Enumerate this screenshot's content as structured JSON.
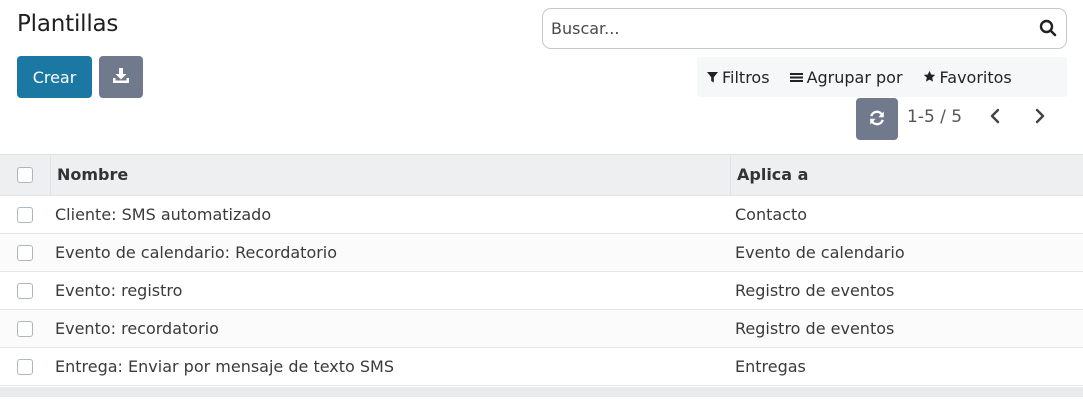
{
  "page": {
    "title": "Plantillas"
  },
  "search": {
    "placeholder": "Buscar..."
  },
  "toolbar": {
    "create_label": "Crear"
  },
  "filters": {
    "filters_label": "Filtros",
    "group_label": "Agrupar por",
    "favorites_label": "Favoritos"
  },
  "pager": {
    "value": "1-5 / 5"
  },
  "table": {
    "columns": [
      "Nombre",
      "Aplica a"
    ],
    "rows": [
      {
        "name": "Cliente: SMS automatizado",
        "applies_to": "Contacto"
      },
      {
        "name": "Evento de calendario: Recordatorio",
        "applies_to": "Evento de calendario"
      },
      {
        "name": "Evento: registro",
        "applies_to": "Registro de eventos"
      },
      {
        "name": "Evento: recordatorio",
        "applies_to": "Registro de eventos"
      },
      {
        "name": "Entrega: Enviar por mensaje de texto SMS",
        "applies_to": "Entregas"
      }
    ]
  },
  "colors": {
    "primary": "#1b78a3",
    "secondary": "#71798c",
    "header_bg": "#eeeff1"
  },
  "icons": [
    "search-icon",
    "download-icon",
    "filter-icon",
    "list-icon",
    "star-icon",
    "refresh-icon",
    "chevron-left-icon",
    "chevron-right-icon"
  ]
}
